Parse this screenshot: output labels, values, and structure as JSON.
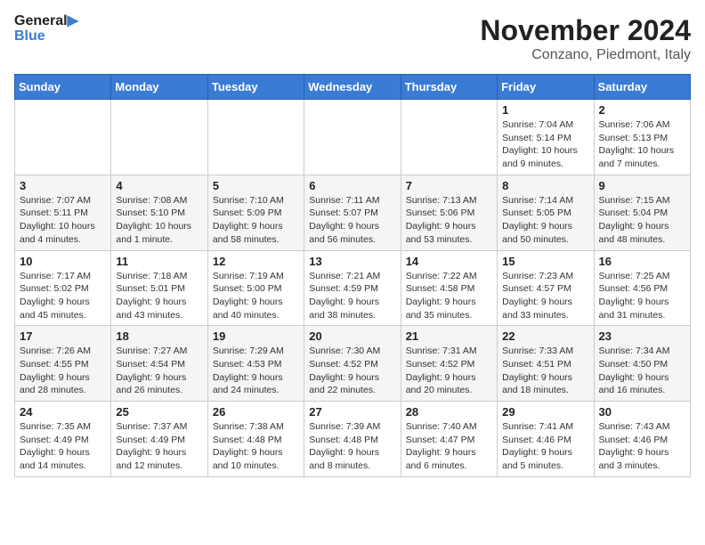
{
  "logo": {
    "line1": "General",
    "line2": "Blue"
  },
  "title": "November 2024",
  "location": "Conzano, Piedmont, Italy",
  "days_of_week": [
    "Sunday",
    "Monday",
    "Tuesday",
    "Wednesday",
    "Thursday",
    "Friday",
    "Saturday"
  ],
  "weeks": [
    [
      {
        "day": "",
        "info": ""
      },
      {
        "day": "",
        "info": ""
      },
      {
        "day": "",
        "info": ""
      },
      {
        "day": "",
        "info": ""
      },
      {
        "day": "",
        "info": ""
      },
      {
        "day": "1",
        "info": "Sunrise: 7:04 AM\nSunset: 5:14 PM\nDaylight: 10 hours and 9 minutes."
      },
      {
        "day": "2",
        "info": "Sunrise: 7:06 AM\nSunset: 5:13 PM\nDaylight: 10 hours and 7 minutes."
      }
    ],
    [
      {
        "day": "3",
        "info": "Sunrise: 7:07 AM\nSunset: 5:11 PM\nDaylight: 10 hours and 4 minutes."
      },
      {
        "day": "4",
        "info": "Sunrise: 7:08 AM\nSunset: 5:10 PM\nDaylight: 10 hours and 1 minute."
      },
      {
        "day": "5",
        "info": "Sunrise: 7:10 AM\nSunset: 5:09 PM\nDaylight: 9 hours and 58 minutes."
      },
      {
        "day": "6",
        "info": "Sunrise: 7:11 AM\nSunset: 5:07 PM\nDaylight: 9 hours and 56 minutes."
      },
      {
        "day": "7",
        "info": "Sunrise: 7:13 AM\nSunset: 5:06 PM\nDaylight: 9 hours and 53 minutes."
      },
      {
        "day": "8",
        "info": "Sunrise: 7:14 AM\nSunset: 5:05 PM\nDaylight: 9 hours and 50 minutes."
      },
      {
        "day": "9",
        "info": "Sunrise: 7:15 AM\nSunset: 5:04 PM\nDaylight: 9 hours and 48 minutes."
      }
    ],
    [
      {
        "day": "10",
        "info": "Sunrise: 7:17 AM\nSunset: 5:02 PM\nDaylight: 9 hours and 45 minutes."
      },
      {
        "day": "11",
        "info": "Sunrise: 7:18 AM\nSunset: 5:01 PM\nDaylight: 9 hours and 43 minutes."
      },
      {
        "day": "12",
        "info": "Sunrise: 7:19 AM\nSunset: 5:00 PM\nDaylight: 9 hours and 40 minutes."
      },
      {
        "day": "13",
        "info": "Sunrise: 7:21 AM\nSunset: 4:59 PM\nDaylight: 9 hours and 38 minutes."
      },
      {
        "day": "14",
        "info": "Sunrise: 7:22 AM\nSunset: 4:58 PM\nDaylight: 9 hours and 35 minutes."
      },
      {
        "day": "15",
        "info": "Sunrise: 7:23 AM\nSunset: 4:57 PM\nDaylight: 9 hours and 33 minutes."
      },
      {
        "day": "16",
        "info": "Sunrise: 7:25 AM\nSunset: 4:56 PM\nDaylight: 9 hours and 31 minutes."
      }
    ],
    [
      {
        "day": "17",
        "info": "Sunrise: 7:26 AM\nSunset: 4:55 PM\nDaylight: 9 hours and 28 minutes."
      },
      {
        "day": "18",
        "info": "Sunrise: 7:27 AM\nSunset: 4:54 PM\nDaylight: 9 hours and 26 minutes."
      },
      {
        "day": "19",
        "info": "Sunrise: 7:29 AM\nSunset: 4:53 PM\nDaylight: 9 hours and 24 minutes."
      },
      {
        "day": "20",
        "info": "Sunrise: 7:30 AM\nSunset: 4:52 PM\nDaylight: 9 hours and 22 minutes."
      },
      {
        "day": "21",
        "info": "Sunrise: 7:31 AM\nSunset: 4:52 PM\nDaylight: 9 hours and 20 minutes."
      },
      {
        "day": "22",
        "info": "Sunrise: 7:33 AM\nSunset: 4:51 PM\nDaylight: 9 hours and 18 minutes."
      },
      {
        "day": "23",
        "info": "Sunrise: 7:34 AM\nSunset: 4:50 PM\nDaylight: 9 hours and 16 minutes."
      }
    ],
    [
      {
        "day": "24",
        "info": "Sunrise: 7:35 AM\nSunset: 4:49 PM\nDaylight: 9 hours and 14 minutes."
      },
      {
        "day": "25",
        "info": "Sunrise: 7:37 AM\nSunset: 4:49 PM\nDaylight: 9 hours and 12 minutes."
      },
      {
        "day": "26",
        "info": "Sunrise: 7:38 AM\nSunset: 4:48 PM\nDaylight: 9 hours and 10 minutes."
      },
      {
        "day": "27",
        "info": "Sunrise: 7:39 AM\nSunset: 4:48 PM\nDaylight: 9 hours and 8 minutes."
      },
      {
        "day": "28",
        "info": "Sunrise: 7:40 AM\nSunset: 4:47 PM\nDaylight: 9 hours and 6 minutes."
      },
      {
        "day": "29",
        "info": "Sunrise: 7:41 AM\nSunset: 4:46 PM\nDaylight: 9 hours and 5 minutes."
      },
      {
        "day": "30",
        "info": "Sunrise: 7:43 AM\nSunset: 4:46 PM\nDaylight: 9 hours and 3 minutes."
      }
    ]
  ]
}
